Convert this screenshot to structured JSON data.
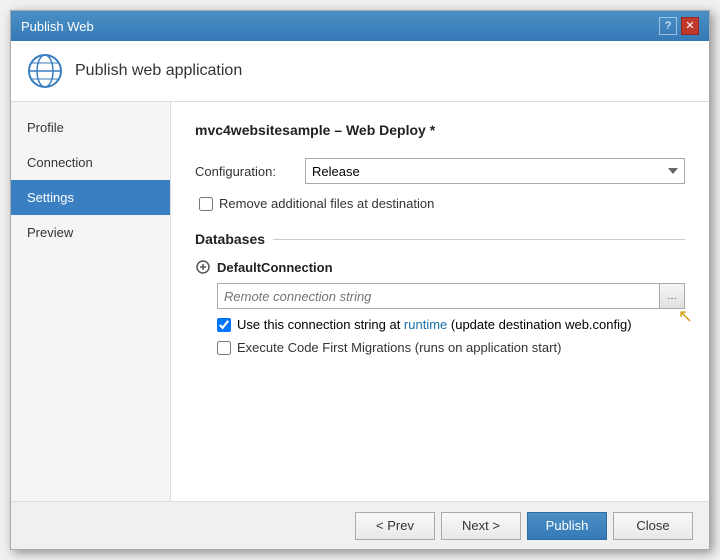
{
  "titleBar": {
    "title": "Publish Web",
    "helpBtn": "?",
    "closeBtn": "✕"
  },
  "header": {
    "title": "Publish web application"
  },
  "sidebar": {
    "items": [
      {
        "id": "profile",
        "label": "Profile"
      },
      {
        "id": "connection",
        "label": "Connection"
      },
      {
        "id": "settings",
        "label": "Settings"
      },
      {
        "id": "preview",
        "label": "Preview"
      }
    ],
    "activeItem": "settings"
  },
  "main": {
    "pageTitle": "mvc4websitesample – Web Deploy *",
    "configLabel": "Configuration:",
    "configValue": "Release",
    "checkboxes": {
      "removeFiles": {
        "label": "Remove additional files at destination",
        "checked": false
      }
    },
    "databasesSection": "Databases",
    "defaultConnection": {
      "name": "DefaultConnection",
      "placeholder": "Remote connection string",
      "useConnectionString": {
        "label": "Use this connection string at runtime (update destination web.config)",
        "checked": true
      },
      "executeCodeFirst": {
        "label": "Execute Code First Migrations (runs on application start)",
        "checked": false
      }
    }
  },
  "footer": {
    "prevBtn": "< Prev",
    "nextBtn": "Next >",
    "publishBtn": "Publish",
    "closeBtn": "Close"
  }
}
